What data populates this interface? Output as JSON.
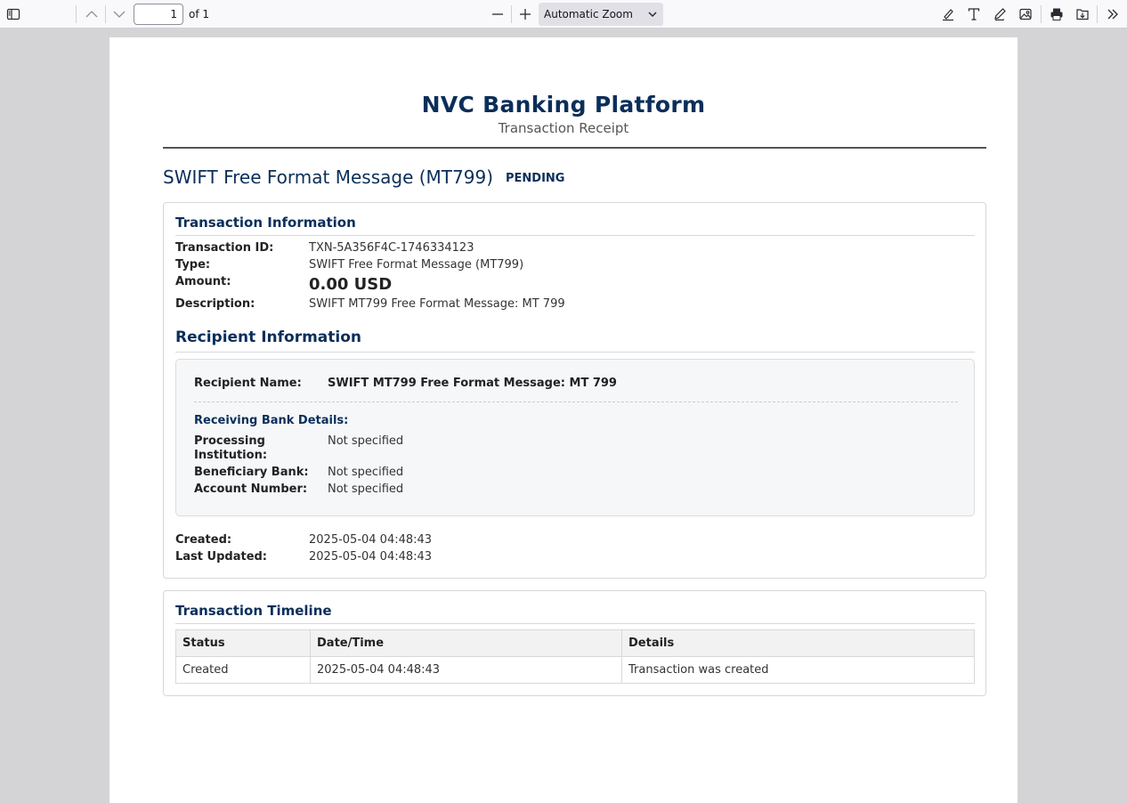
{
  "toolbar": {
    "page_number": "1",
    "page_count": "of 1",
    "zoom": "Automatic Zoom",
    "icons": [
      "sidebar-toggle-icon",
      "previous-page-icon",
      "next-page-icon",
      "zoom-out-icon",
      "zoom-in-icon",
      "highlight-icon",
      "text-icon",
      "draw-icon",
      "image-icon",
      "print-icon",
      "save-icon",
      "tools-icon"
    ]
  },
  "receipt": {
    "brand": "NVC Banking Platform",
    "subtitle": "Transaction Receipt",
    "message_title": "SWIFT Free Format Message (MT799)",
    "status": "PENDING",
    "transaction_info": {
      "heading": "Transaction Information",
      "id_label": "Transaction ID:",
      "id": "TXN-5A356F4C-1746334123",
      "type_label": "Type:",
      "type": "SWIFT Free Format Message (MT799)",
      "amount_label": "Amount:",
      "amount": "0.00 USD",
      "description_label": "Description:",
      "description": "SWIFT MT799 Free Format Message: MT 799"
    },
    "recipient_info": {
      "heading": "Recipient Information",
      "name_label": "Recipient Name:",
      "name": "SWIFT MT799 Free Format Message: MT 799",
      "bank_heading": "Receiving Bank Details:",
      "processing_label_1": "Processing",
      "processing_label_2": "Institution:",
      "processing": "Not specified",
      "beneficiary_label": "Beneficiary Bank:",
      "beneficiary": "Not specified",
      "account_label": "Account Number:",
      "account": "Not specified"
    },
    "dates": {
      "created_label": "Created:",
      "created": "2025-05-04 04:48:43",
      "updated_label": "Last Updated:",
      "updated": "2025-05-04 04:48:43"
    },
    "timeline": {
      "heading": "Transaction Timeline",
      "columns": [
        "Status",
        "Date/Time",
        "Details"
      ],
      "rows": [
        [
          "Created",
          "2025-05-04 04:48:43",
          "Transaction was created"
        ]
      ]
    }
  }
}
